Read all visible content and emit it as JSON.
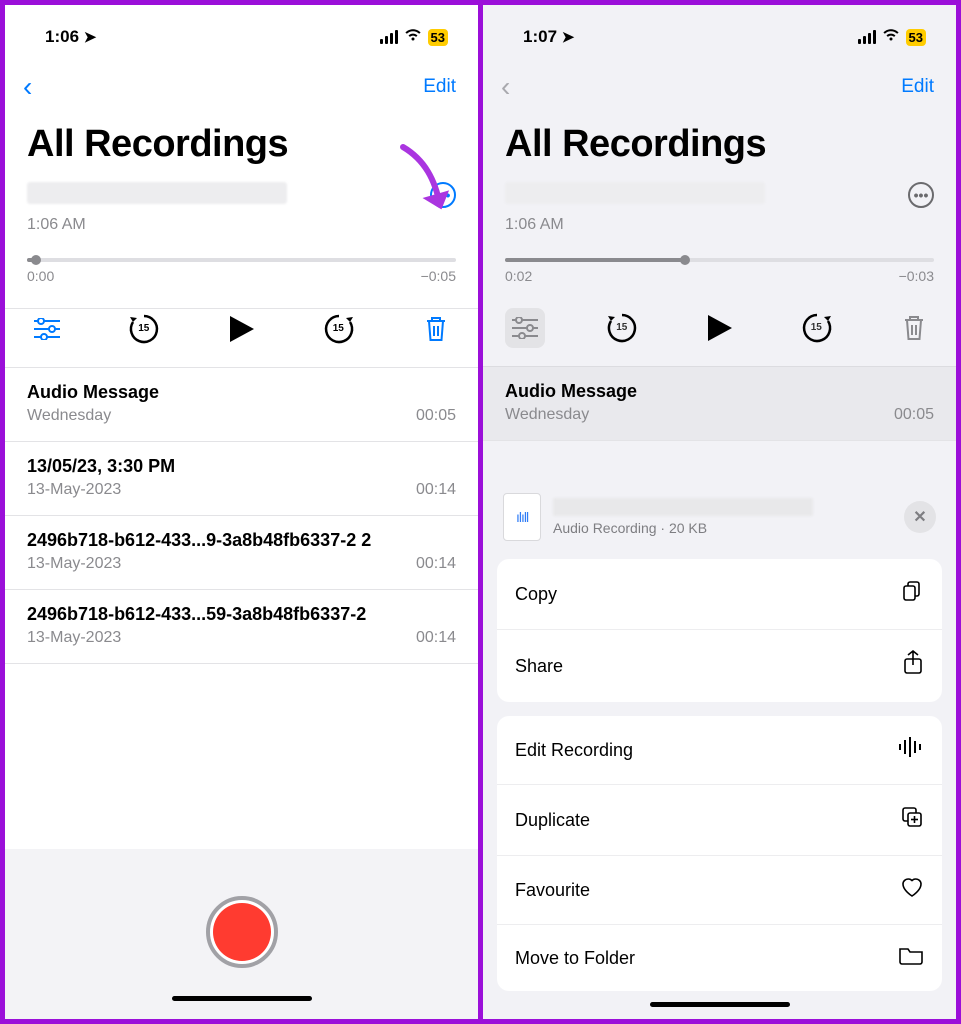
{
  "left": {
    "status": {
      "time": "1:06",
      "battery": "53"
    },
    "nav": {
      "edit": "Edit"
    },
    "title": "All Recordings",
    "current": {
      "subtitle": "1:06 AM",
      "t_start": "0:00",
      "t_end": "−0:05",
      "progress_pct": 2
    },
    "list": [
      {
        "title": "Audio Message",
        "subtitle": "Wednesday",
        "duration": "00:05"
      },
      {
        "title": "13/05/23, 3:30 PM",
        "subtitle": "13-May-2023",
        "duration": "00:14"
      },
      {
        "title": "2496b718-b612-433...9-3a8b48fb6337-2 2",
        "subtitle": "13-May-2023",
        "duration": "00:14"
      },
      {
        "title": "2496b718-b612-433...59-3a8b48fb6337-2",
        "subtitle": "13-May-2023",
        "duration": "00:14"
      }
    ]
  },
  "right": {
    "status": {
      "time": "1:07",
      "battery": "53"
    },
    "nav": {
      "edit": "Edit"
    },
    "title": "All Recordings",
    "current": {
      "subtitle": "1:06 AM",
      "t_start": "0:02",
      "t_end": "−0:03",
      "progress_pct": 42
    },
    "visible_item": {
      "title": "Audio Message",
      "subtitle": "Wednesday",
      "duration": "00:05"
    },
    "sheet": {
      "meta": "Audio Recording · 20 KB",
      "group1": [
        {
          "label": "Copy",
          "icon": "⧉"
        },
        {
          "label": "Share",
          "icon": "⇧"
        }
      ],
      "group2": [
        {
          "label": "Edit Recording",
          "icon": "ılıl"
        },
        {
          "label": "Duplicate",
          "icon": "⊞"
        },
        {
          "label": "Favourite",
          "icon": "♡"
        },
        {
          "label": "Move to Folder",
          "icon": "▭"
        }
      ]
    }
  }
}
